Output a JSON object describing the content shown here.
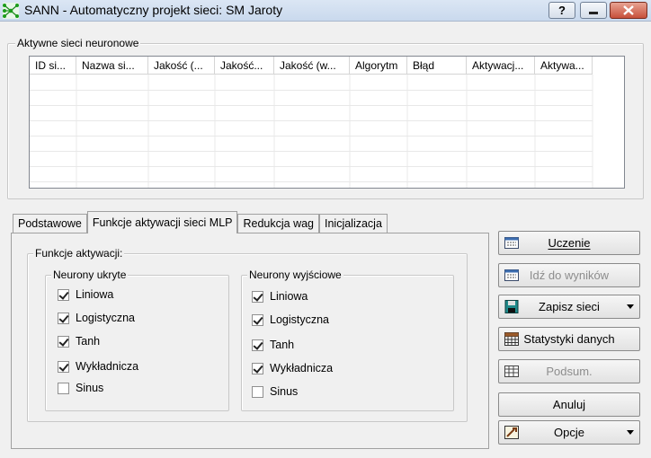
{
  "window": {
    "title": "SANN - Automatyczny projekt sieci: SM Jaroty",
    "help_label": "?"
  },
  "networks": {
    "legend": "Aktywne sieci neuronowe",
    "columns": [
      "ID si...",
      "Nazwa si...",
      "Jakość (...",
      "Jakość...",
      "Jakość (w...",
      "Algorytm",
      "Błąd",
      "Aktywacj...",
      "Aktywa..."
    ],
    "rows": []
  },
  "tabs": [
    "Podstawowe",
    "Funkcje aktywacji sieci MLP",
    "Redukcja wag",
    "Inicjalizacja"
  ],
  "activation": {
    "legend": "Funkcje aktywacji:",
    "hidden": {
      "legend": "Neurony ukryte",
      "items": [
        {
          "label": "Liniowa",
          "checked": true
        },
        {
          "label": "Logistyczna",
          "checked": true
        },
        {
          "label": "Tanh",
          "checked": true
        },
        {
          "label": "Wykładnicza",
          "checked": true
        },
        {
          "label": "Sinus",
          "checked": false
        }
      ]
    },
    "output": {
      "legend": "Neurony wyjściowe",
      "items": [
        {
          "label": "Liniowa",
          "checked": true
        },
        {
          "label": "Logistyczna",
          "checked": true
        },
        {
          "label": "Tanh",
          "checked": true
        },
        {
          "label": "Wykładnicza",
          "checked": true
        },
        {
          "label": "Sinus",
          "checked": false
        }
      ]
    }
  },
  "buttons": {
    "train": "Uczenie",
    "go_results": "Idź do wyników",
    "save": "Zapisz sieci",
    "stats": "Statystyki danych",
    "summary": "Podsum.",
    "cancel": "Anuluj",
    "options": "Opcje"
  }
}
